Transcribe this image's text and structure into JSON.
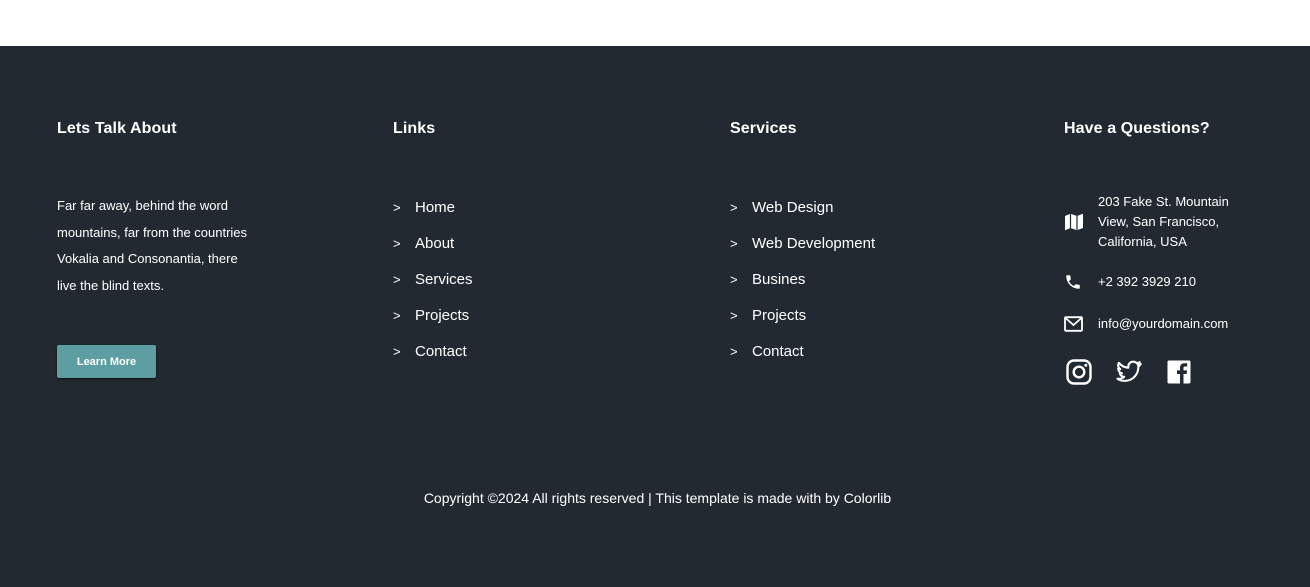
{
  "about": {
    "heading": "Lets Talk About",
    "text": "Far far away, behind the word mountains, far from the countries Vokalia and Consonantia, there live the blind texts.",
    "button_label": "Learn More"
  },
  "links": {
    "heading": "Links",
    "items": [
      {
        "label": "Home"
      },
      {
        "label": "About"
      },
      {
        "label": "Services"
      },
      {
        "label": "Projects"
      },
      {
        "label": "Contact"
      }
    ]
  },
  "services": {
    "heading": "Services",
    "items": [
      {
        "label": "Web Design"
      },
      {
        "label": "Web Development"
      },
      {
        "label": "Busines"
      },
      {
        "label": "Projects"
      },
      {
        "label": "Contact"
      }
    ]
  },
  "contact": {
    "heading": "Have a Questions?",
    "address": "203 Fake St. Mountain View, San Francisco, California, USA",
    "phone": "+2 392 3929 210",
    "email": "info@yourdomain.com",
    "social": [
      "instagram-icon",
      "twitter-icon",
      "facebook-icon"
    ]
  },
  "list_marker": ">",
  "copyright": "Copyright ©2024 All rights reserved | This template is made with by Colorlib",
  "colors": {
    "footer_bg": "#232931",
    "button_bg": "#5c9ea1",
    "text": "#ffffff"
  }
}
